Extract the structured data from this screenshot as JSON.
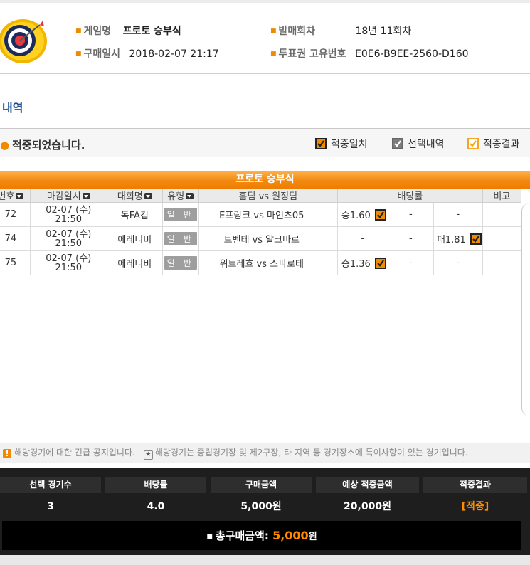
{
  "header": {
    "game_name_label": "게임명",
    "game_name": "프로토 승부식",
    "purchase_date_label": "구매일시",
    "purchase_date": "2018-02-07 21:17",
    "round_label": "발매회차",
    "round": "18년 11회차",
    "ticket_id_label": "투표권 고유번호",
    "ticket_id": "E0E6-B9EE-2560-D160"
  },
  "section_title": "내역",
  "status_message": "적중되었습니다.",
  "legend": {
    "hit_match": "적중일치",
    "selection": "선택내역",
    "result": "적중결과"
  },
  "table": {
    "title": "프로토 승부식",
    "columns": {
      "number": "번호",
      "deadline": "마감일시",
      "league": "대회명",
      "type": "유형",
      "teams": "홈팀 vs 원정팀",
      "odds": "배당률",
      "note": "비고"
    },
    "rows": [
      {
        "no": "72",
        "date": "02-07 (수)",
        "time": "21:50",
        "league": "독FA컵",
        "type": "일 반",
        "match": "E프랑크 vs 마인츠05",
        "win": "승1.60",
        "draw": "-",
        "lose": "-"
      },
      {
        "no": "74",
        "date": "02-07 (수)",
        "time": "21:50",
        "league": "에레디비",
        "type": "일 반",
        "match": "트벤테 vs 알크마르",
        "win": "-",
        "draw": "-",
        "lose": "패1.81"
      },
      {
        "no": "75",
        "date": "02-07 (수)",
        "time": "21:50",
        "league": "에레디비",
        "type": "일 반",
        "match": "위트레흐 vs 스파로테",
        "win": "승1.36",
        "draw": "-",
        "lose": "-"
      }
    ]
  },
  "notice": {
    "urgent": "해당경기에 대한 긴급 공지입니다.",
    "neutral": "해당경기는 중립경기장 및 제2구장, 타 지역 등 경기장소에 특이사항이 있는 경기입니다."
  },
  "summary": {
    "count_label": "선택 경기수",
    "count": "3",
    "odds_label": "배당률",
    "odds": "4.0",
    "amount_label": "구매금액",
    "amount": "5,000원",
    "expected_label": "예상 적중금액",
    "expected": "20,000원",
    "result_label": "적중결과",
    "result": "[적중]",
    "total_label": "총구매금액:",
    "total_amount": "5,000",
    "total_unit": "원"
  },
  "colors": {
    "accent": "#f08a00",
    "title_blue": "#1d4f91",
    "panel_dark": "#1e1e1e"
  },
  "icons": [
    "target-logo-icon",
    "checkbox-checked-icon",
    "alert-icon",
    "star-icon",
    "sort-icon"
  ]
}
